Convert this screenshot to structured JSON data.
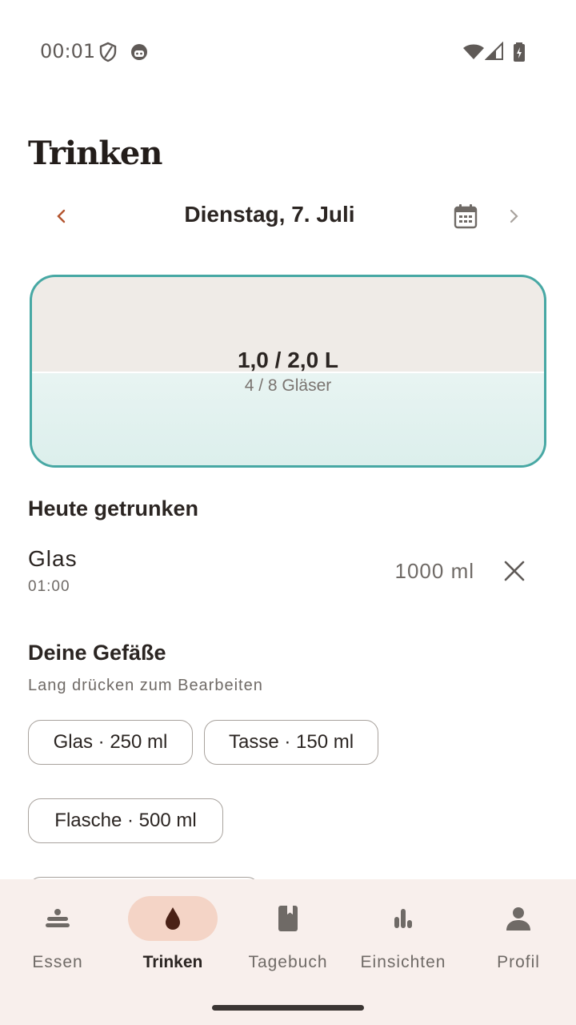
{
  "status": {
    "time": "00:01"
  },
  "header": {
    "title": "Trinken"
  },
  "date_nav": {
    "date_label": "Dienstag, 7. Juli"
  },
  "summary": {
    "amount_label": "1,0 / 2,0 L",
    "glasses_label": "4 / 8 Gläser",
    "fill_fraction": 0.5
  },
  "today": {
    "title": "Heute getrunken",
    "entries": [
      {
        "name": "Glas",
        "time": "01:00",
        "amount": "1000 ml"
      }
    ]
  },
  "vessels": {
    "title": "Deine Gefäße",
    "hint": "Lang drücken zum Bearbeiten",
    "items": [
      {
        "label": "Glas · 250 ml"
      },
      {
        "label": "Tasse · 150 ml"
      },
      {
        "label": "Flasche · 500 ml"
      }
    ]
  },
  "bottom_nav": {
    "items": [
      {
        "label": "Essen",
        "icon": "food-icon",
        "active": false
      },
      {
        "label": "Trinken",
        "icon": "drop-icon",
        "active": true
      },
      {
        "label": "Tagebuch",
        "icon": "notebook-icon",
        "active": false
      },
      {
        "label": "Einsichten",
        "icon": "bar-chart-icon",
        "active": false
      },
      {
        "label": "Profil",
        "icon": "person-icon",
        "active": false
      }
    ]
  },
  "colors": {
    "accent": "#47a8a4",
    "back_arrow": "#b3552f",
    "active_nav_pill": "#f4d4c6",
    "nav_background": "#f8efec"
  }
}
